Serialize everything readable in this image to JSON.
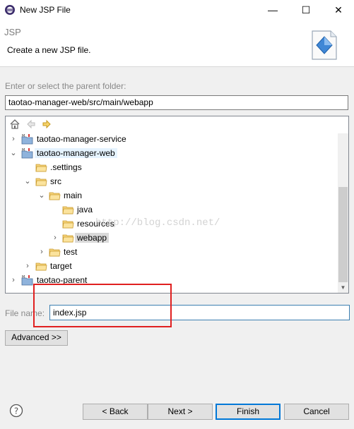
{
  "window": {
    "title": "New JSP File",
    "minimize_glyph": "—",
    "maximize_glyph": "☐",
    "close_glyph": "✕"
  },
  "banner": {
    "title": "JSP",
    "description": "Create a new JSP file."
  },
  "folder": {
    "label": "Enter or select the parent folder:",
    "value": "taotao-manager-web/src/main/webapp"
  },
  "tree": {
    "toolbar_icons": [
      "home-icon",
      "back-arrow-icon",
      "forward-arrow-icon"
    ],
    "items": [
      {
        "label": "taotao-manager-service",
        "expanded": false,
        "icon": "maven-project-icon"
      },
      {
        "label": "taotao-manager-web",
        "expanded": true,
        "icon": "maven-project-icon"
      },
      {
        "label": ".settings",
        "icon": "folder-icon"
      },
      {
        "label": "src",
        "expanded": true,
        "icon": "folder-open-icon"
      },
      {
        "label": "main",
        "expanded": true,
        "icon": "folder-open-icon"
      },
      {
        "label": "java",
        "icon": "folder-icon"
      },
      {
        "label": "resources",
        "icon": "folder-icon"
      },
      {
        "label": "webapp",
        "expanded": false,
        "selected": true,
        "icon": "folder-open-icon"
      },
      {
        "label": "test",
        "expanded": false,
        "icon": "folder-icon"
      },
      {
        "label": "target",
        "expanded": false,
        "icon": "folder-icon"
      },
      {
        "label": "taotao-parent",
        "expanded": false,
        "icon": "maven-project-icon"
      }
    ],
    "watermark": "http://blog.csdn.net/"
  },
  "filename": {
    "label": "File name:",
    "value": "index.jsp"
  },
  "advanced_label": "Advanced >>",
  "buttons": {
    "back": "< Back",
    "next": "Next >",
    "finish": "Finish",
    "cancel": "Cancel"
  },
  "colors": {
    "accent": "#0078d7",
    "highlight_box": "#e02020",
    "folder": "#e8b84a"
  }
}
